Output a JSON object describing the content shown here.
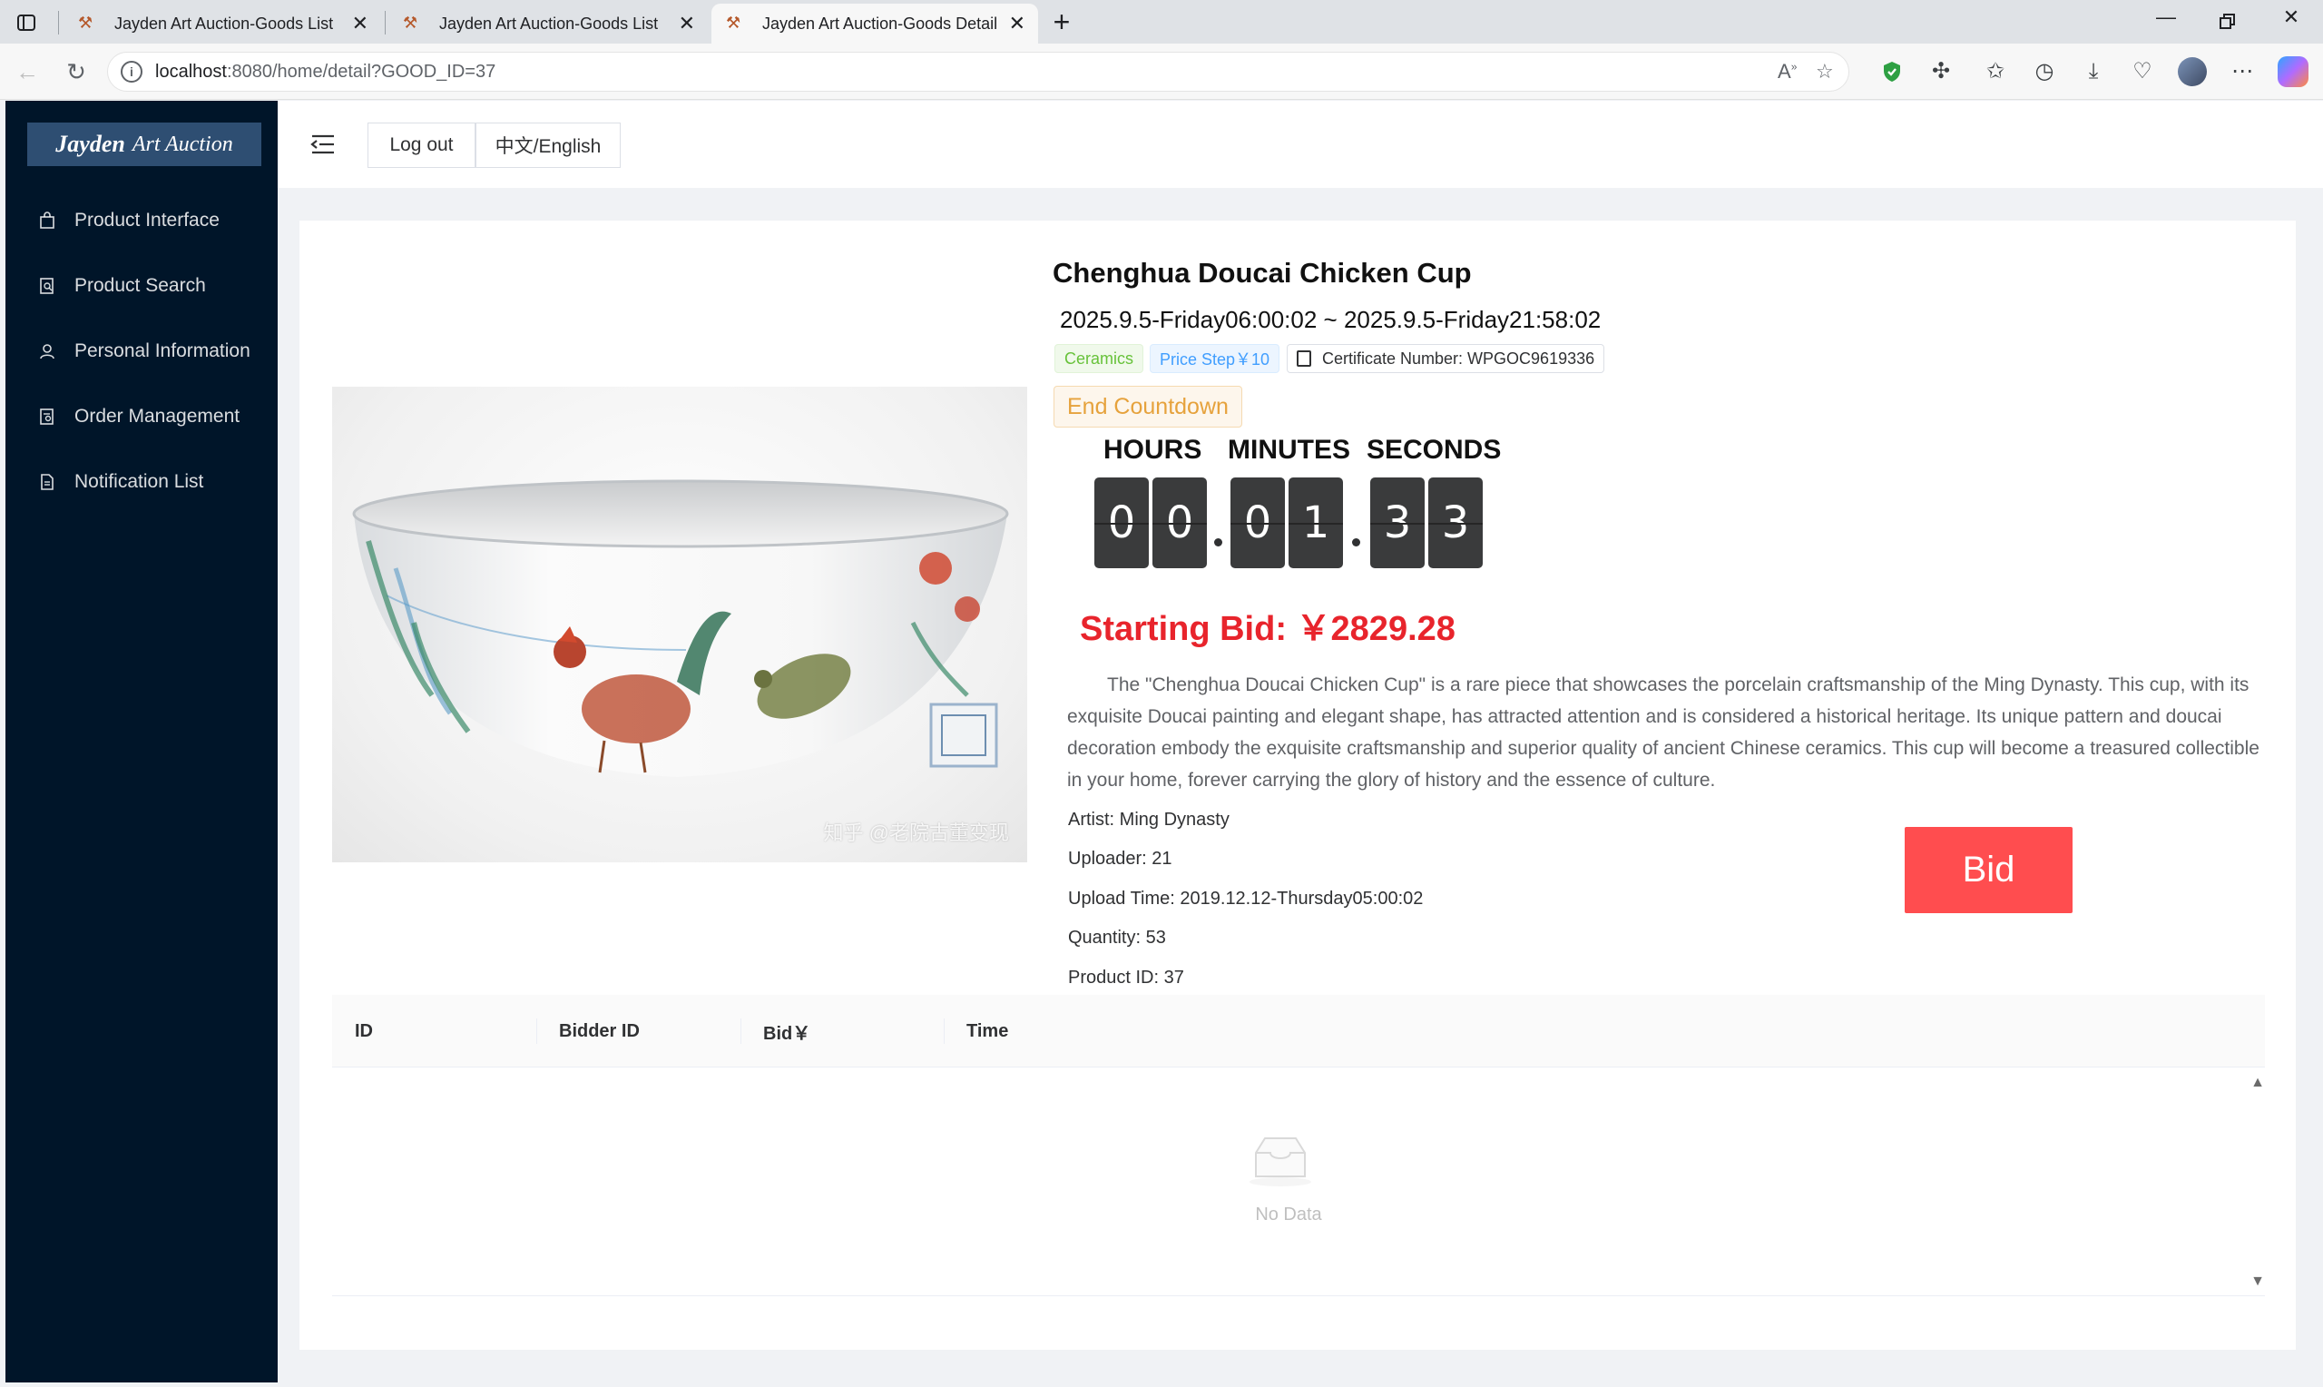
{
  "browser": {
    "tabs": [
      {
        "title": "Jayden Art Auction-Goods List",
        "active": false
      },
      {
        "title": "Jayden Art Auction-Goods List",
        "active": false
      },
      {
        "title": "Jayden Art Auction-Goods Detail",
        "active": true
      }
    ],
    "url_host": "localhost",
    "url_rest": ":8080/home/detail?GOOD_ID=37"
  },
  "sidebar": {
    "logo_bold": "Jayden",
    "logo_rest": "Art Auction",
    "items": [
      {
        "label": "Product Interface",
        "icon": "shopping-bag-icon"
      },
      {
        "label": "Product Search",
        "icon": "search-document-icon"
      },
      {
        "label": "Personal Information",
        "icon": "user-icon"
      },
      {
        "label": "Order Management",
        "icon": "order-document-icon"
      },
      {
        "label": "Notification List",
        "icon": "document-icon"
      }
    ]
  },
  "header": {
    "logout_label": "Log out",
    "language_label": "中文/English"
  },
  "product": {
    "title": "Chenghua Doucai Chicken Cup",
    "date_range": "2025.9.5-Friday06:00:02 ~ 2025.9.5-Friday21:58:02",
    "category_tag": "Ceramics",
    "price_step_tag": "Price Step￥10",
    "certificate_tag": "Certificate Number: WPGOC9619336",
    "countdown_title": "End Countdown",
    "countdown_labels": {
      "hours": "HOURS",
      "minutes": "MINUTES",
      "seconds": "SECONDS"
    },
    "countdown_digits": [
      "0",
      "0",
      "0",
      "1",
      "3",
      "3"
    ],
    "starting_bid": "Starting Bid: ￥2829.28",
    "description": "The \"Chenghua Doucai Chicken Cup\" is a rare piece that showcases the porcelain craftsmanship of the Ming Dynasty. This cup, with its exquisite Doucai painting and elegant shape, has attracted attention and is considered a historical heritage. Its unique pattern and doucai decoration embody the exquisite craftsmanship and superior quality of ancient Chinese ceramics. This cup will become a treasured collectible in your home, forever carrying the glory of history and the essence of culture.",
    "artist": "Artist: Ming Dynasty",
    "uploader": "Uploader: 21",
    "upload_time": "Upload Time: 2019.12.12-Thursday05:00:02",
    "quantity": "Quantity: 53",
    "product_id": "Product ID: 37",
    "image_watermark": "知乎 @老院古董变现",
    "bid_label": "Bid"
  },
  "table": {
    "columns": [
      "ID",
      "Bidder ID",
      "Bid￥",
      "Time"
    ],
    "rows": [],
    "empty_text": "No Data"
  },
  "colors": {
    "sidebar_bg": "#001529",
    "bid_red": "#ff4d4f",
    "price_red": "#e8242c",
    "countdown_orange": "#e6a23c"
  }
}
